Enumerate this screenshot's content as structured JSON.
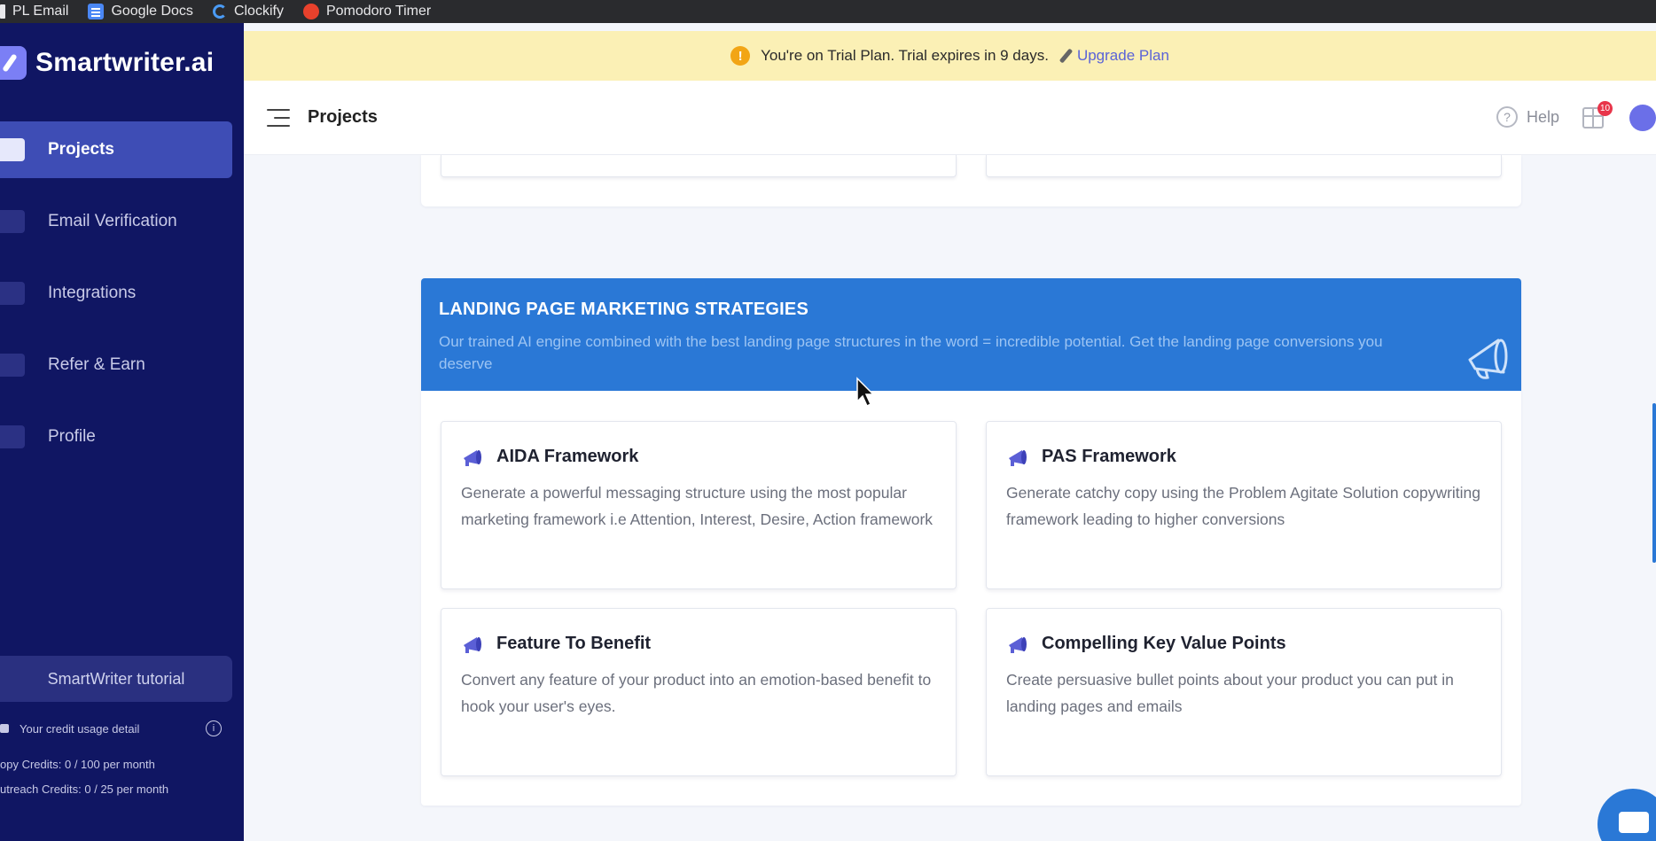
{
  "bookmarks": [
    {
      "label": "PL Email",
      "icon": "pl-icon"
    },
    {
      "label": "Google Docs",
      "icon": "google-docs-icon"
    },
    {
      "label": "Clockify",
      "icon": "clockify-icon"
    },
    {
      "label": "Pomodoro Timer",
      "icon": "tomato-icon"
    }
  ],
  "brand": {
    "name": "Smartwriter.ai"
  },
  "sidebar": {
    "items": [
      {
        "label": "Projects",
        "icon": "folder-icon",
        "active": true
      },
      {
        "label": "Email Verification",
        "icon": "bolt-icon"
      },
      {
        "label": "Integrations",
        "icon": "puzzle-icon"
      },
      {
        "label": "Refer & Earn",
        "icon": "wallet-icon"
      },
      {
        "label": "Profile",
        "icon": "user-icon"
      }
    ],
    "tutorial": "SmartWriter tutorial",
    "credits": {
      "title": "Your credit usage detail",
      "copy": "opy Credits: 0 / 100 per month",
      "outreach": "utreach Credits: 0 / 25 per month"
    }
  },
  "banner": {
    "message": "You're on Trial Plan. Trial expires in 9 days.",
    "upgrade": "Upgrade Plan"
  },
  "header": {
    "title": "Projects",
    "help": "Help",
    "gift_badge": "10"
  },
  "section": {
    "title": "LANDING PAGE MARKETING STRATEGIES",
    "description": "Our trained AI engine combined with the best landing page structures in the word = incredible potential. Get the landing page conversions you deserve"
  },
  "cards": [
    {
      "title": "AIDA Framework",
      "desc": "Generate a powerful messaging structure using the most popular marketing framework i.e Attention, Interest, Desire, Action framework"
    },
    {
      "title": "PAS Framework",
      "desc": "Generate catchy copy using the Problem Agitate Solution copywriting framework leading to higher conversions"
    },
    {
      "title": "Feature To Benefit",
      "desc": "Convert any feature of your product into an emotion-based benefit to hook your user's eyes."
    },
    {
      "title": "Compelling Key Value Points",
      "desc": "Create persuasive bullet points about your product you can put in landing pages and emails"
    }
  ],
  "colors": {
    "sidebar": "#101663",
    "accent": "#2a78d6",
    "active": "#3e4db5",
    "banner": "#fbf0b5"
  }
}
